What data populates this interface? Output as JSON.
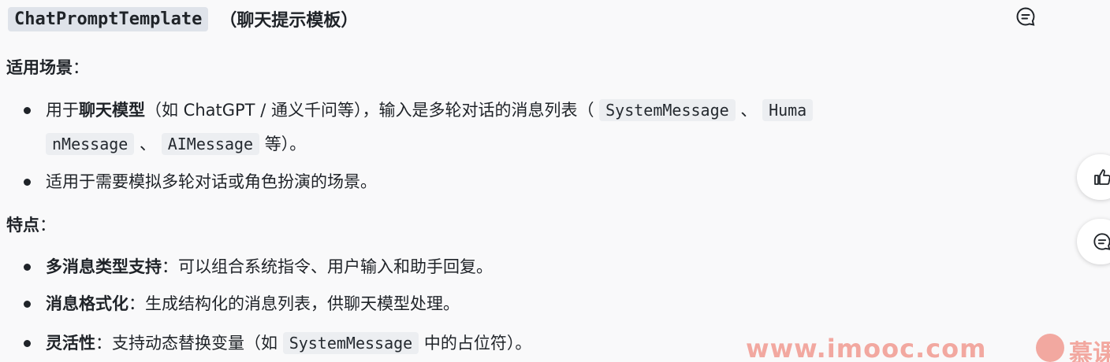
{
  "header": {
    "title_code": "ChatPromptTemplate",
    "title_text": "（聊天提示模板）",
    "comment_icon": "comment-icon"
  },
  "sections": {
    "scenario": {
      "heading": "适用场景",
      "colon": "：",
      "item1": {
        "pre": "用于",
        "bold": "聊天模型",
        "mid": "（如 ChatGPT / 通义千问等），输入是多轮对话的消息列表（",
        "code1": "SystemMessage",
        "sep1": "、",
        "code2a": "Huma",
        "code2b": "nMessage",
        "sep2": "、",
        "code3": "AIMessage",
        "post": "等）。"
      },
      "item2": "适用于需要模拟多轮对话或角色扮演的场景。"
    },
    "features": {
      "heading": "特点",
      "colon": "：",
      "item1": {
        "bold": "多消息类型支持",
        "rest": "：可以组合系统指令、用户输入和助手回复。"
      },
      "item2": {
        "bold": "消息格式化",
        "rest": "：生成结构化的消息列表，供聊天模型处理。"
      },
      "item3": {
        "bold": "灵活性",
        "pre": "：支持动态替换变量（如",
        "code": "SystemMessage",
        "post": "中的占位符）。"
      }
    }
  },
  "side_actions": {
    "like_icon": "thumbs-up-icon",
    "comment_icon": "comment-icon"
  },
  "watermark": {
    "site": "www.imooc.com",
    "brand": "慕课"
  },
  "colors": {
    "watermark": "#f2a8a0",
    "code_bg": "#eceef1",
    "text": "#1f2328"
  }
}
